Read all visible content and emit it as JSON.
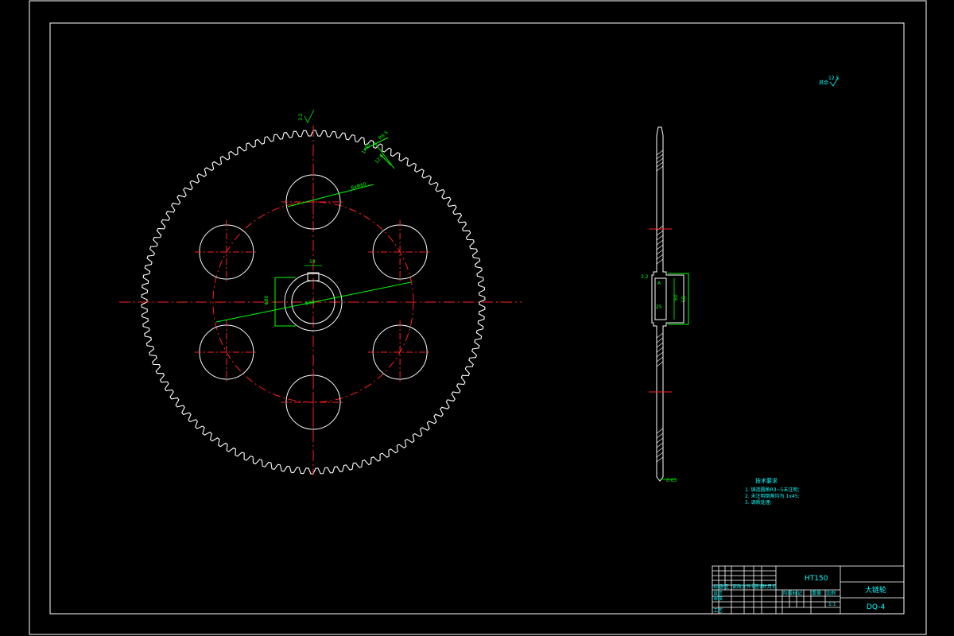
{
  "drawing": {
    "title_name": "大链轮",
    "drawing_number": "DQ-4",
    "material": "HT150",
    "scale": "1:1",
    "roughness_note": "其余",
    "roughness_value": "12.5",
    "tech_requirements": {
      "heading": "技术要求",
      "items": [
        "1. 铸造圆角R3~5未注明;",
        "2. 未注明倒角均为 1x45;",
        "3. 调质处理;"
      ]
    },
    "dimensions": {
      "tooth_pitch": "R6.5",
      "chamfer": "1x45",
      "tooth_len": "12.6",
      "hole_circle": "6xΦ60",
      "key": "14",
      "bore": "Φ50",
      "hub": "Φ80",
      "tooth_rough": "3.2",
      "side_rough": "3.2",
      "hub_width": "58",
      "hub_height": "60",
      "side_mark": "A",
      "bottom_mark": "0.03",
      "angle_mark": "6.3",
      "small_mark": "25",
      "inner_bore": "Φ55"
    },
    "title_block": {
      "rows": [
        "标记",
        "设计",
        "审核",
        "工艺"
      ],
      "columns": [
        "处数",
        "分区",
        "更改文件号",
        "签名",
        "年月日"
      ],
      "stage": [
        "阶段标记",
        "重量",
        "比例"
      ]
    }
  }
}
